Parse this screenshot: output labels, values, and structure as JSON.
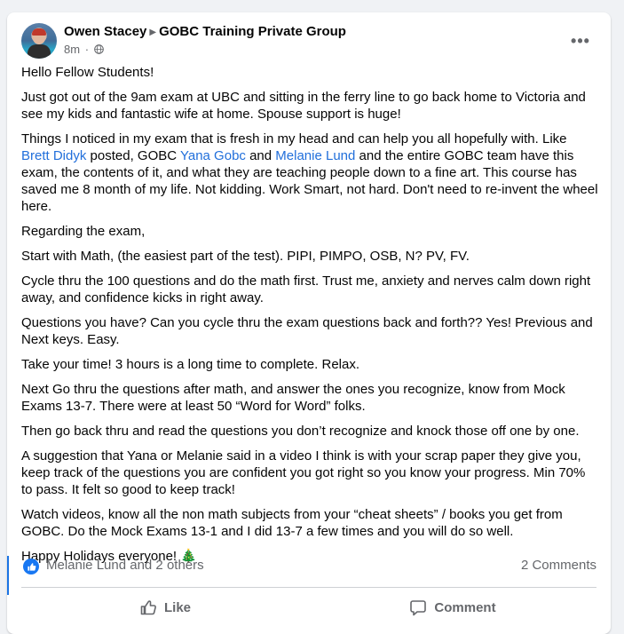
{
  "post": {
    "author": "Owen Stacey",
    "group": "GOBC Training Private Group",
    "time": "8m",
    "separator": "·",
    "paragraphs": [
      {
        "segments": [
          {
            "text": "Hello Fellow Students!"
          }
        ]
      },
      {
        "segments": [
          {
            "text": "Just got out of the 9am exam at UBC and sitting in the ferry line to go back home to Victoria and see my kids and fantastic wife at home.  Spouse support is huge!"
          }
        ]
      },
      {
        "segments": [
          {
            "text": "Things I noticed in my exam that is fresh in my head and can help you all hopefully with.  Like "
          },
          {
            "text": "Brett Didyk",
            "link": true
          },
          {
            "text": " posted, GOBC "
          },
          {
            "text": "Yana Gobc",
            "link": true
          },
          {
            "text": " and "
          },
          {
            "text": "Melanie Lund",
            "link": true
          },
          {
            "text": " and the entire GOBC team have this exam, the contents of it, and what they are teaching people down to a fine art.  This course has saved me 8 month of my life.  Not kidding.  Work Smart, not hard.  Don't need to re-invent the wheel here."
          }
        ]
      },
      {
        "segments": [
          {
            "text": "Regarding the exam,"
          }
        ]
      },
      {
        "segments": [
          {
            "text": "Start with Math, (the easiest part of the test). PIPI, PIMPO, OSB, N? PV, FV."
          }
        ]
      },
      {
        "segments": [
          {
            "text": "Cycle thru the 100 questions and do the math first. Trust me, anxiety and nerves calm down right away, and confidence kicks in right away."
          }
        ]
      },
      {
        "segments": [
          {
            "text": "Questions you have?  Can you cycle thru the exam questions back and forth??  Yes!  Previous and Next keys. Easy."
          }
        ]
      },
      {
        "segments": [
          {
            "text": "Take your time! 3 hours is a long time to complete.  Relax."
          }
        ]
      },
      {
        "segments": [
          {
            "text": "Next Go thru the questions after math, and answer the ones you recognize, know from Mock Exams 13-7. There were at least 50 “Word for Word” folks."
          }
        ]
      },
      {
        "segments": [
          {
            "text": "Then go back thru and read the questions you don’t recognize and knock those off one by one."
          }
        ]
      },
      {
        "segments": [
          {
            "text": "A suggestion that Yana or Melanie said in a video I think is with your scrap paper they give you, keep track of the questions you are confident you got right so you know your progress. Min 70% to pass.  It felt so good to keep track!"
          }
        ]
      },
      {
        "segments": [
          {
            "text": "Watch videos, know all the non math subjects from your “cheat sheets” / books you get from GOBC. Do the Mock Exams 13-1 and I did 13-7 a few times and you will do so well."
          }
        ]
      },
      {
        "segments": [
          {
            "text": "Happy Holidays everyone! "
          },
          {
            "text": "🎄",
            "tree": true
          }
        ]
      }
    ]
  },
  "reactions": {
    "text": "Melanie Lund and 2 others",
    "comments": "2 Comments"
  },
  "actions": {
    "like": "Like",
    "comment": "Comment"
  },
  "icons": {
    "more": "more-options-icon",
    "globe": "globe-icon",
    "like_reaction": "thumbs-up-icon",
    "like_action": "thumbs-up-outline-icon",
    "comment_action": "comment-bubble-icon"
  },
  "colors": {
    "link": "#216fdb",
    "reaction_blue": "#1877f2",
    "secondary_text": "#65676b"
  }
}
